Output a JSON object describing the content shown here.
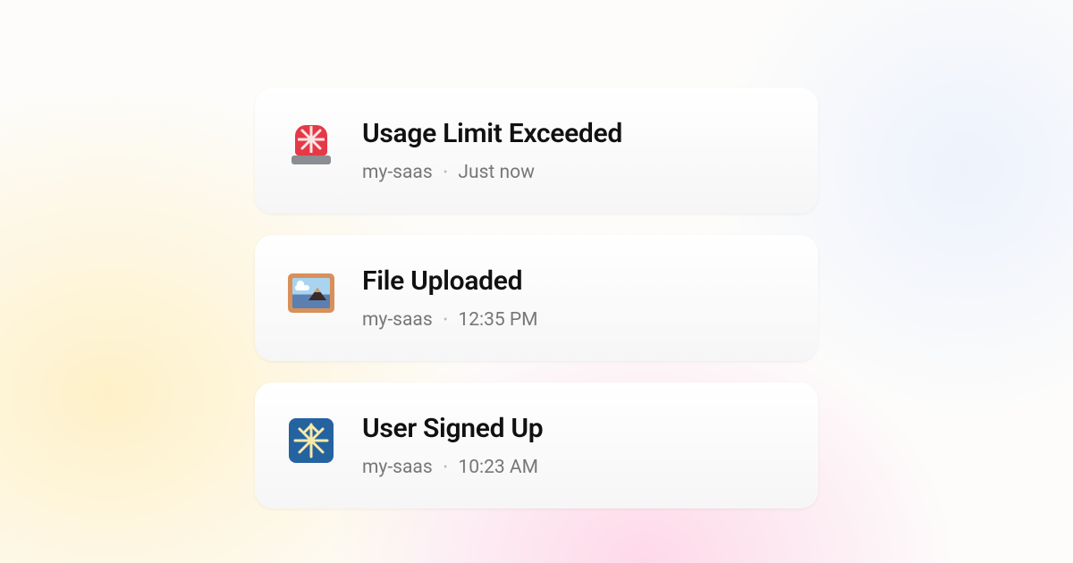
{
  "notifications": [
    {
      "icon": "siren-icon",
      "title": "Usage Limit Exceeded",
      "source": "my-saas",
      "time": "Just now"
    },
    {
      "icon": "picture-icon",
      "title": "File Uploaded",
      "source": "my-saas",
      "time": "12:35 PM"
    },
    {
      "icon": "starburst-icon",
      "title": "User Signed Up",
      "source": "my-saas",
      "time": "10:23 AM"
    }
  ],
  "separator": "•"
}
